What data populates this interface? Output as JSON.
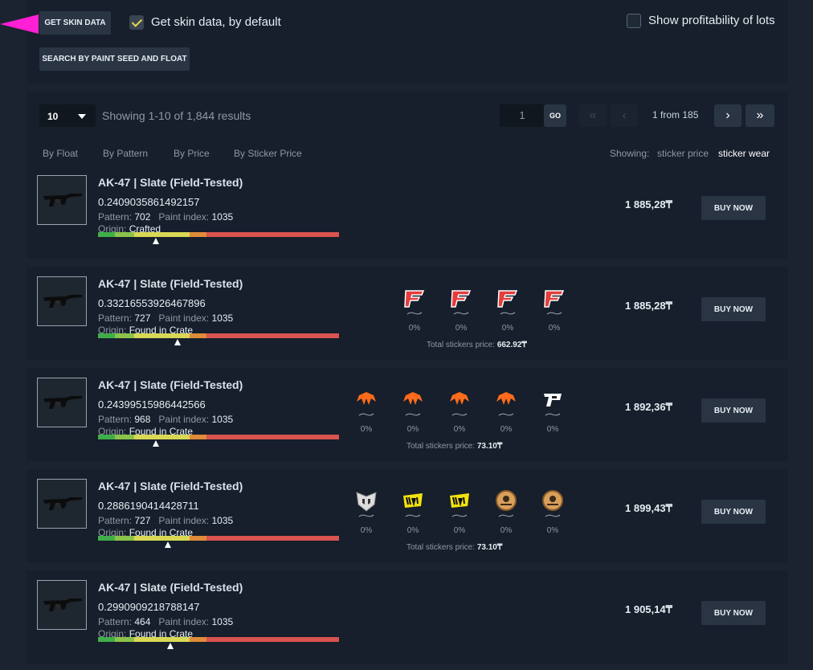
{
  "controls": {
    "get_skin_data": "GET SKIN DATA",
    "get_skin_data_default": "Get skin data, by default",
    "search_paint_seed": "SEARCH BY PAINT SEED AND FLOAT",
    "show_profitability": "Show profitability of lots"
  },
  "toolbar": {
    "page_size": "10",
    "results_text": "Showing 1-10 of 1,844 results",
    "page_input": "1",
    "go_label": "GO",
    "page_info": "1 from 185",
    "sort_by_float": "By Float",
    "sort_by_pattern": "By Pattern",
    "sort_by_price": "By Price",
    "sort_by_sticker_price": "By Sticker Price",
    "showing_label": "Showing:",
    "sticker_price": "sticker price",
    "sticker_wear": "sticker wear"
  },
  "common": {
    "pattern_label": "Pattern:",
    "paint_index_label": "Paint index:",
    "origin_label": "Origin:",
    "buy_now": "BUY NOW",
    "total_stickers_label": "Total stickers price:"
  },
  "listings": [
    {
      "name": "AK-47 | Slate (Field-Tested)",
      "float": "0.2409035861492157",
      "pattern": "702",
      "paint_index": "1035",
      "origin": "Crafted",
      "price": "1 885,28₸",
      "stickers": [],
      "total_stickers": "",
      "wear_pos": 0.24
    },
    {
      "name": "AK-47 | Slate (Field-Tested)",
      "float": "0.33216553926467896",
      "pattern": "727",
      "paint_index": "1035",
      "origin": "Found in Crate",
      "price": "1 885,28₸",
      "stickers": [
        {
          "icon": "faze-sticker-icon",
          "wear": "0%"
        },
        {
          "icon": "faze-sticker-icon",
          "wear": "0%"
        },
        {
          "icon": "faze-sticker-icon",
          "wear": "0%"
        },
        {
          "icon": "faze-sticker-icon",
          "wear": "0%"
        }
      ],
      "total_stickers": "662.92₸",
      "wear_pos": 0.33
    },
    {
      "name": "AK-47 | Slate (Field-Tested)",
      "float": "0.24399515986442566",
      "pattern": "968",
      "paint_index": "1035",
      "origin": "Found in Crate",
      "price": "1 892,36₸",
      "stickers": [
        {
          "icon": "fnatic-sticker-icon",
          "wear": "0%"
        },
        {
          "icon": "fnatic-sticker-icon",
          "wear": "0%"
        },
        {
          "icon": "fnatic-sticker-icon",
          "wear": "0%"
        },
        {
          "icon": "fnatic-sticker-icon",
          "wear": "0%"
        },
        {
          "icon": "pain-sticker-icon",
          "wear": "0%"
        }
      ],
      "total_stickers": "73.10₸",
      "wear_pos": 0.24
    },
    {
      "name": "AK-47 | Slate (Field-Tested)",
      "float": "0.2886190414428711",
      "pattern": "727",
      "paint_index": "1035",
      "origin": "Found in Crate",
      "price": "1 899,43₸",
      "stickers": [
        {
          "icon": "heroic-sticker-icon",
          "wear": "0%"
        },
        {
          "icon": "navi-sticker-icon",
          "wear": "0%"
        },
        {
          "icon": "navi-sticker-icon",
          "wear": "0%"
        },
        {
          "icon": "ence-sticker-icon",
          "wear": "0%"
        },
        {
          "icon": "ence-sticker-icon",
          "wear": "0%"
        }
      ],
      "total_stickers": "73.10₸",
      "wear_pos": 0.29
    },
    {
      "name": "AK-47 | Slate (Field-Tested)",
      "float": "0.2990909218788147",
      "pattern": "464",
      "paint_index": "1035",
      "origin": "Found in Crate",
      "price": "1 905,14₸",
      "stickers": [],
      "total_stickers": "",
      "wear_pos": 0.3
    }
  ],
  "colors": {
    "accent_arrow": "#ff1fd4",
    "check": "#e8d64c",
    "wear_fn": "#3fae49",
    "wear_mw": "#8bc34a",
    "wear_ft": "#d8d855",
    "wear_ww": "#e08b3a",
    "wear_bs": "#d9534f"
  }
}
